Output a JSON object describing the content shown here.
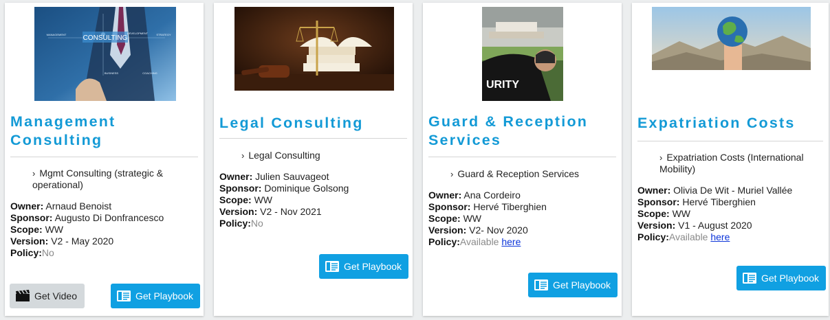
{
  "cards": [
    {
      "title": "Management Consulting",
      "item": "Mgmt Consulting (strategic & operational)",
      "owner_label": "Owner:",
      "owner": "Arnaud Benoist",
      "sponsor_label": "Sponsor:",
      "sponsor": "Augusto Di Donfrancesco",
      "scope_label": "Scope:",
      "scope": "WW",
      "version_label": "Version:",
      "version": "V2 - May 2020",
      "policy_label": "Policy:",
      "policy": "No",
      "video_label": "Get Video",
      "playbook_label": "Get Playbook"
    },
    {
      "title": "Legal Consulting",
      "item": "Legal Consulting",
      "owner_label": "Owner:",
      "owner": "Julien Sauvageot",
      "sponsor_label": "Sponsor:",
      "sponsor": "Dominique Golsong",
      "scope_label": "Scope:",
      "scope": "WW",
      "version_label": "Version:",
      "version": "V2 - Nov 2021",
      "policy_label": "Policy:",
      "policy": "No",
      "playbook_label": "Get Playbook"
    },
    {
      "title": "Guard & Reception Services",
      "item": "Guard & Reception Services",
      "owner_label": "Owner:",
      "owner": "Ana Cordeiro",
      "sponsor_label": "Sponsor:",
      "sponsor": "Hervé Tiberghien",
      "scope_label": "Scope:",
      "scope": "WW",
      "version_label": "Version:",
      "version": "V2- Nov 2020",
      "policy_label": "Policy:",
      "policy": "Available",
      "policy_link": "here",
      "image_text": "URITY",
      "playbook_label": "Get Playbook"
    },
    {
      "title": "Expatriation Costs",
      "item": "Expatriation Costs (International Mobility)",
      "owner_label": "Owner:",
      "owner": "Olivia De Wit - Muriel Vallée",
      "sponsor_label": "Sponsor:",
      "sponsor": "Hervé Tiberghien",
      "scope_label": "Scope:",
      "scope": "WW",
      "version_label": "Version:",
      "version": "V1 - August 2020",
      "policy_label": "Policy:",
      "policy": "Available",
      "policy_link": "here",
      "playbook_label": "Get Playbook"
    }
  ],
  "image_words": {
    "consulting": "CONSULTING",
    "management": "MANAGEMENT",
    "development": "DEVELOPMENT",
    "strategy": "STRATEGY",
    "business": "BUSINESS",
    "coaching": "COACHING"
  },
  "icons": {
    "video": "clapperboard-icon",
    "playbook": "document-icon"
  },
  "colors": {
    "title": "#139ad6",
    "primary_button": "#10a0e2",
    "secondary_button": "#d4d9dc",
    "link": "#0b34d9",
    "muted": "#8a8a8a"
  }
}
